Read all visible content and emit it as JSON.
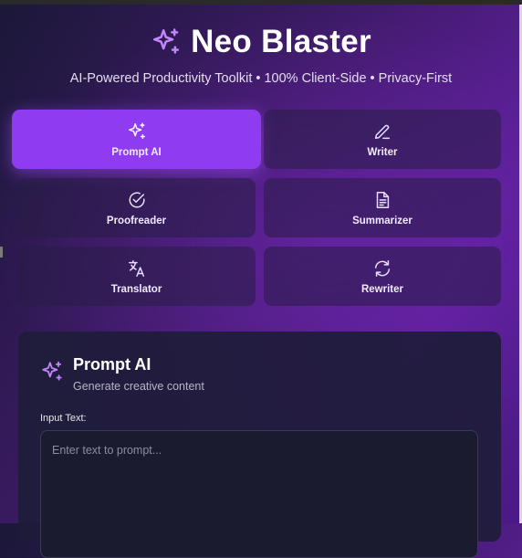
{
  "app": {
    "title": "Neo Blaster",
    "subtitle": "AI-Powered Productivity Toolkit • 100% Client-Side • Privacy-First"
  },
  "tools": [
    {
      "label": "Prompt AI",
      "icon": "sparkles-icon",
      "active": true
    },
    {
      "label": "Writer",
      "icon": "pen-icon",
      "active": false
    },
    {
      "label": "Proofreader",
      "icon": "check-circle-icon",
      "active": false
    },
    {
      "label": "Summarizer",
      "icon": "document-icon",
      "active": false
    },
    {
      "label": "Translator",
      "icon": "translate-icon",
      "active": false
    },
    {
      "label": "Rewriter",
      "icon": "refresh-icon",
      "active": false
    }
  ],
  "panel": {
    "title": "Prompt AI",
    "subtitle": "Generate creative content",
    "input_label": "Input Text:",
    "input_placeholder": "Enter text to prompt...",
    "input_value": ""
  },
  "colors": {
    "accent": "#8f3cf0",
    "icon_purple": "#c084fc",
    "panel_bg": "#1e1c3a"
  }
}
